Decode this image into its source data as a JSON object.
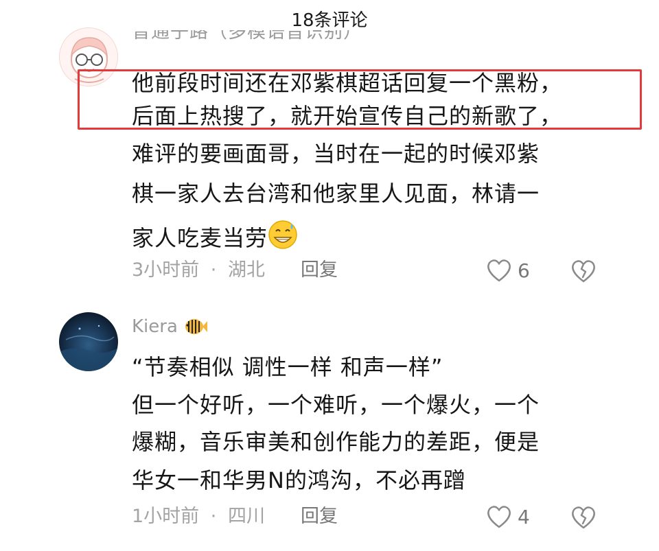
{
  "header": {
    "title": "18条评论"
  },
  "comments": [
    {
      "username": "普通子路（多模语音识别）",
      "lines": [
        "他前段时间还在邓紫棋超话回复一个黑粉，",
        "后面上热搜了，就开始宣传自己的新歌了，",
        "难评的要画面哥，当时在一起的时候邓紫",
        "棋一家人去台湾和他家里人见面，林请一",
        "家人吃麦当劳"
      ],
      "emoji": "grinning-sweat-emoji",
      "time": "3小时前",
      "location": "湖北",
      "meta_sep": "·",
      "reply_label": "回复",
      "likes": "6"
    },
    {
      "username": "Kiera",
      "badge": "fish-badge-icon",
      "lines": [
        "“节奏相似 调性一样 和声一样”",
        "但一个好听，一个难听，一个爆火，一个",
        "爆糊，音乐审美和创作能力的差距，便是",
        "华女一和华男N的鸿沟，不必再蹭"
      ],
      "time": "1小时前",
      "location": "四川",
      "meta_sep": "·",
      "reply_label": "回复",
      "likes": "4"
    }
  ],
  "colors": {
    "highlight": "#e23a3a",
    "meta": "#a3a3a3",
    "text": "#161616"
  }
}
